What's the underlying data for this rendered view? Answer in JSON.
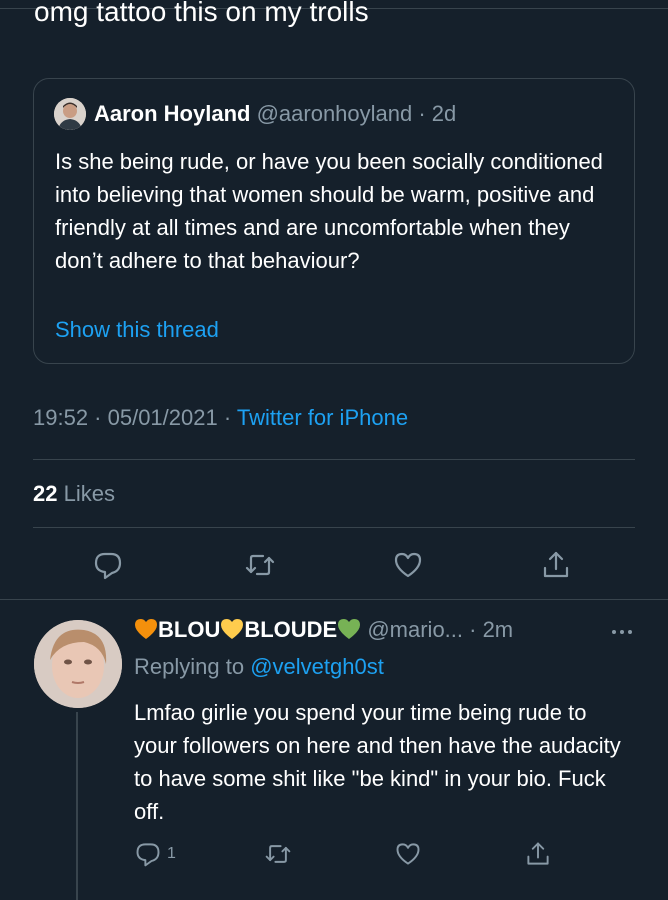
{
  "tweet": {
    "text_partial": "omg tattoo this on my trolls",
    "timestamp": "19:52 · 05/01/2021 · ",
    "source": "Twitter for iPhone",
    "likes_count": "22",
    "likes_label": " Likes"
  },
  "quote": {
    "name": "Aaron Hoyland",
    "handle_time": " @aaronhoyland · 2d",
    "body": "Is she being rude, or have you been socially conditioned into believing that women should be warm, positive and friendly at all times and are uncomfortable when they don’t adhere to that behaviour?",
    "thread_link": "Show this thread"
  },
  "reply": {
    "name_part1": "BLOU",
    "name_part2": "BLOUDE",
    "handle_time": " @mario... · 2m",
    "replying_label": "Replying to ",
    "replying_handle": "@velvetgh0st",
    "body": "Lmfao girlie you spend your time being rude to your followers on here and then have the audacity to have some shit like \"be kind\" in your bio. Fuck off.",
    "reply_count": "1"
  },
  "icons": {
    "reply": "reply-icon",
    "retweet": "retweet-icon",
    "like": "like-icon",
    "share": "share-icon",
    "more": "more-icon",
    "heart_orange": "#f4900c",
    "heart_yellow": "#ffcc4d",
    "heart_green": "#77b255"
  },
  "colors": {
    "background": "#15202b",
    "accent": "#1da1f2",
    "secondary_text": "#8899a6",
    "border": "#38444d"
  }
}
